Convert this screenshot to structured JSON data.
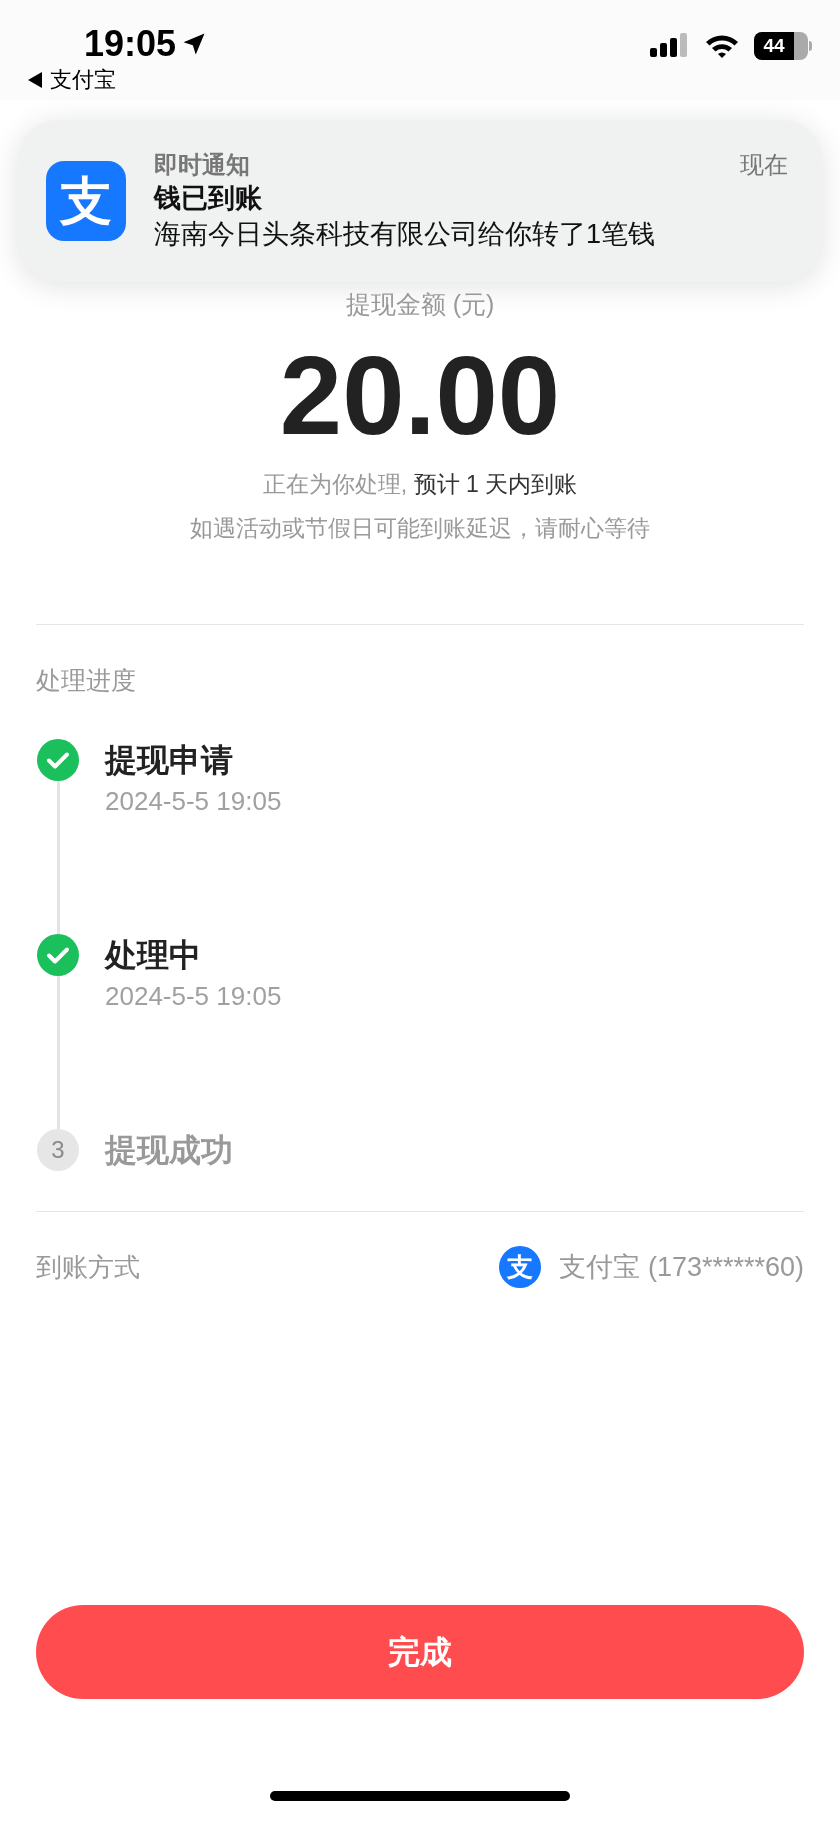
{
  "status_bar": {
    "time": "19:05",
    "back_app": "支付宝",
    "battery": "44"
  },
  "notification": {
    "logo_glyph": "支",
    "app": "即时通知",
    "time": "现在",
    "title": "钱已到账",
    "body": "海南今日头条科技有限公司给你转了1笔钱"
  },
  "amount": {
    "label": "提现金额 (元)",
    "value": "20.00",
    "note_prefix": "正在为你处理, ",
    "note_emphasis": "预计 1 天内到账",
    "note2": "如遇活动或节假日可能到账延迟，请耐心等待"
  },
  "progress": {
    "title": "处理进度",
    "steps": [
      {
        "title": "提现申请",
        "time": "2024-5-5 19:05",
        "done": true
      },
      {
        "title": "处理中",
        "time": "2024-5-5 19:05",
        "done": true
      },
      {
        "title": "提现成功",
        "number": "3",
        "done": false
      }
    ]
  },
  "method": {
    "label": "到账方式",
    "logo_glyph": "支",
    "value": "支付宝 (173******60)"
  },
  "button": "完成"
}
